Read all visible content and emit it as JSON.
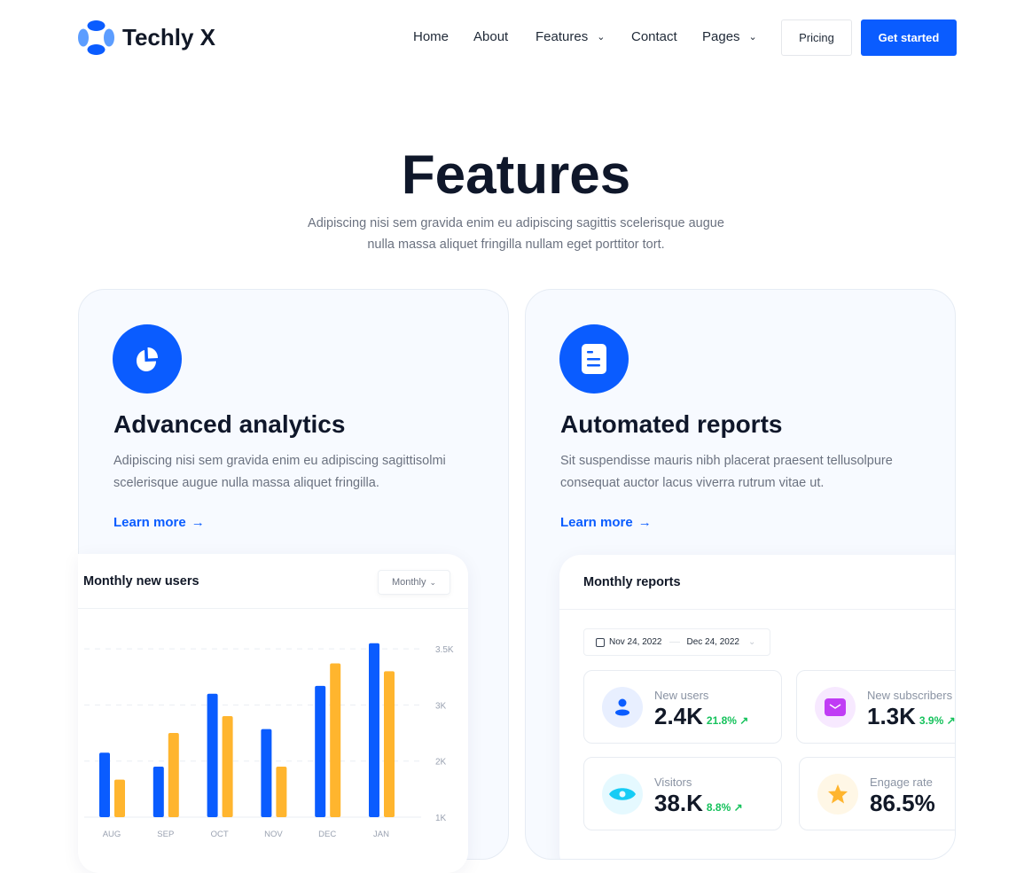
{
  "header": {
    "brand": "Techly X",
    "nav": [
      {
        "label": "Home"
      },
      {
        "label": "About"
      },
      {
        "label": "Features",
        "dropdown": true
      },
      {
        "label": "Contact"
      },
      {
        "label": "Pages",
        "dropdown": true
      }
    ],
    "pricing_label": "Pricing",
    "cta_label": "Get started"
  },
  "hero": {
    "title": "Features",
    "subtitle": "Adipiscing nisi sem gravida enim eu adipiscing sagittis scelerisque augue nulla massa aliquet fringilla nullam eget porttitor tort."
  },
  "colors": {
    "accent": "#0a5cff",
    "series2": "#ffb52e",
    "positive": "#16c25c"
  },
  "cards": [
    {
      "icon": "pie-chart-icon",
      "title": "Advanced analytics",
      "description": "Adipiscing nisi sem gravida enim eu adipiscing sagittisolmi scelerisque augue nulla massa aliquet fringilla.",
      "link": "Learn more"
    },
    {
      "icon": "document-icon",
      "title": "Automated reports",
      "description": "Sit suspendisse mauris nibh placerat praesent tellusolpure consequat auctor lacus viverra rutrum vitae ut.",
      "link": "Learn more"
    }
  ],
  "analytics_widget": {
    "title": "Monthly new users",
    "period_select": "Monthly"
  },
  "chart_data": {
    "type": "bar",
    "categories": [
      "AUG",
      "SEP",
      "OCT",
      "NOV",
      "DEC",
      "JAN"
    ],
    "series": [
      {
        "color": "#0a5cff",
        "values": [
          2150,
          1900,
          3100,
          2570,
          3170,
          3550
        ]
      },
      {
        "color": "#ffb52e",
        "values": [
          1670,
          2500,
          2800,
          1900,
          3370,
          3300
        ]
      }
    ],
    "yticks": [
      {
        "value": 1000,
        "label": "1K"
      },
      {
        "value": 2000,
        "label": "2K"
      },
      {
        "value": 3000,
        "label": "3K"
      },
      {
        "value": 3500,
        "label": "3.5K"
      }
    ],
    "ylim": [
      1000,
      3500
    ],
    "grid": true,
    "y_axis_position": "right"
  },
  "reports_widget": {
    "title": "Monthly reports",
    "date_from": "Nov 24, 2022",
    "date_to": "Dec 24, 2022",
    "stats": [
      {
        "label": "New users",
        "value": "2.4K",
        "change": "21.8% ↗",
        "icon": "user-icon"
      },
      {
        "label": "New subscribers",
        "value": "1.3K",
        "change": "3.9% ↗",
        "icon": "mail-icon"
      },
      {
        "label": "Visitors",
        "value": "38.K",
        "change": "8.8% ↗",
        "icon": "eye-icon"
      },
      {
        "label": "Engage rate",
        "value": "86.5%",
        "change": "",
        "icon": "star-icon"
      }
    ]
  }
}
